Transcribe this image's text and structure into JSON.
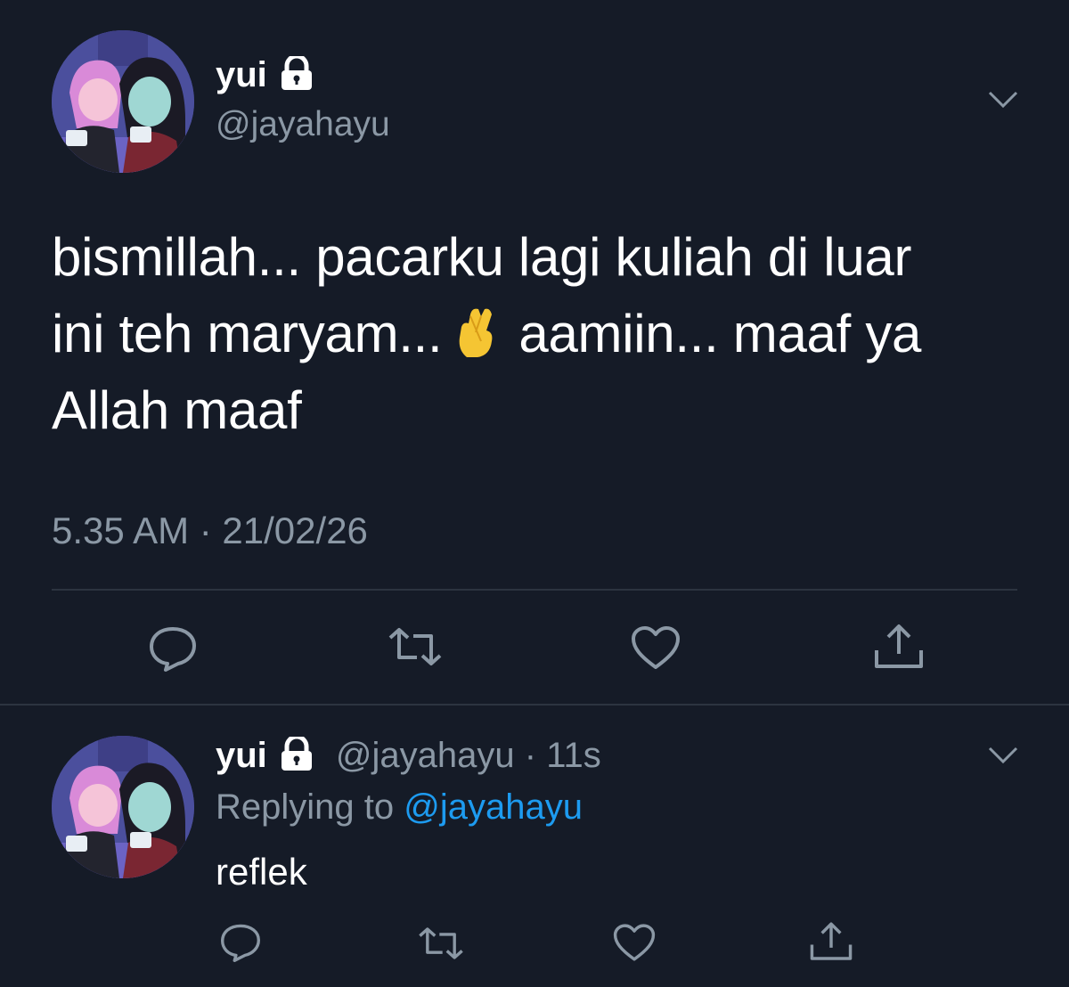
{
  "tweet": {
    "author_name": "yui",
    "author_handle": "@jayahayu",
    "text_line1": "bismillah... pacarku lagi kuliah di luar",
    "text_line2a": "ini teh maryam...",
    "text_line2b": "aamiin... maaf ya",
    "text_line3": "Allah maaf",
    "emoji": "crossed-fingers",
    "timestamp": "5.35 AM · 21/02/26"
  },
  "reply": {
    "author_name": "yui",
    "author_handle": "@jayahayu",
    "time_ago": "· 11s",
    "replying_prefix": "Replying to",
    "replying_mention": "@jayahayu",
    "text": "reflek"
  },
  "icons": [
    "lock-icon",
    "chevron-down-icon",
    "reply-icon",
    "retweet-icon",
    "like-icon",
    "share-icon"
  ],
  "colors": {
    "background": "#151b27",
    "secondary_text": "#8b98a5",
    "link": "#1d9bf0",
    "divider": "#2c3440"
  }
}
